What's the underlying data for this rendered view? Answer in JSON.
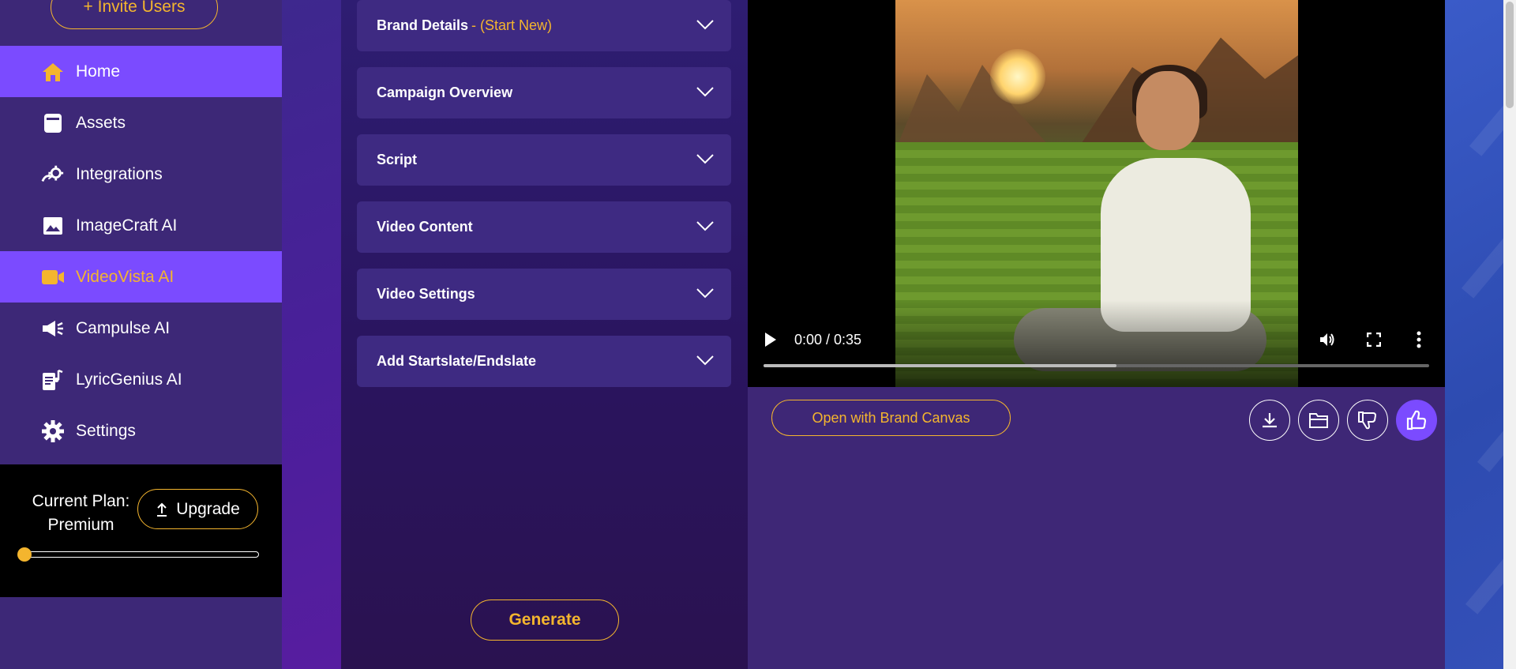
{
  "sidebar": {
    "invite_label": "+ Invite Users",
    "items": [
      {
        "label": "Home",
        "icon": "home-icon",
        "state": "active"
      },
      {
        "label": "Assets",
        "icon": "assets-icon",
        "state": ""
      },
      {
        "label": "Integrations",
        "icon": "integrations-icon",
        "state": ""
      },
      {
        "label": "ImageCraft AI",
        "icon": "image-icon",
        "state": ""
      },
      {
        "label": "VideoVista AI",
        "icon": "video-camera-icon",
        "state": "current"
      },
      {
        "label": "Campulse AI",
        "icon": "megaphone-icon",
        "state": ""
      },
      {
        "label": "LyricGenius AI",
        "icon": "lyrics-icon",
        "state": ""
      },
      {
        "label": "Settings",
        "icon": "gear-icon",
        "state": ""
      }
    ],
    "plan": {
      "label_line1": "Current Plan:",
      "label_line2": "Premium",
      "upgrade_label": "Upgrade",
      "slider_value": 0
    }
  },
  "form": {
    "sections": [
      {
        "title": "Brand Details",
        "note": "- (Start New)"
      },
      {
        "title": "Campaign Overview",
        "note": ""
      },
      {
        "title": "Script",
        "note": ""
      },
      {
        "title": "Video Content",
        "note": ""
      },
      {
        "title": "Video Settings",
        "note": ""
      },
      {
        "title": "Add Startslate/Endslate",
        "note": ""
      }
    ],
    "generate_label": "Generate"
  },
  "player": {
    "time": "0:00 / 0:35",
    "progress": 0.53
  },
  "actions": {
    "open_brand_canvas_label": "Open with Brand Canvas",
    "buttons": [
      "download-icon",
      "folder-icon",
      "thumbs-down-icon",
      "thumbs-up-icon"
    ]
  },
  "colors": {
    "accent_yellow": "#f4b52e",
    "accent_purple": "#7b4bff",
    "sidebar_bg": "#3d2877"
  }
}
